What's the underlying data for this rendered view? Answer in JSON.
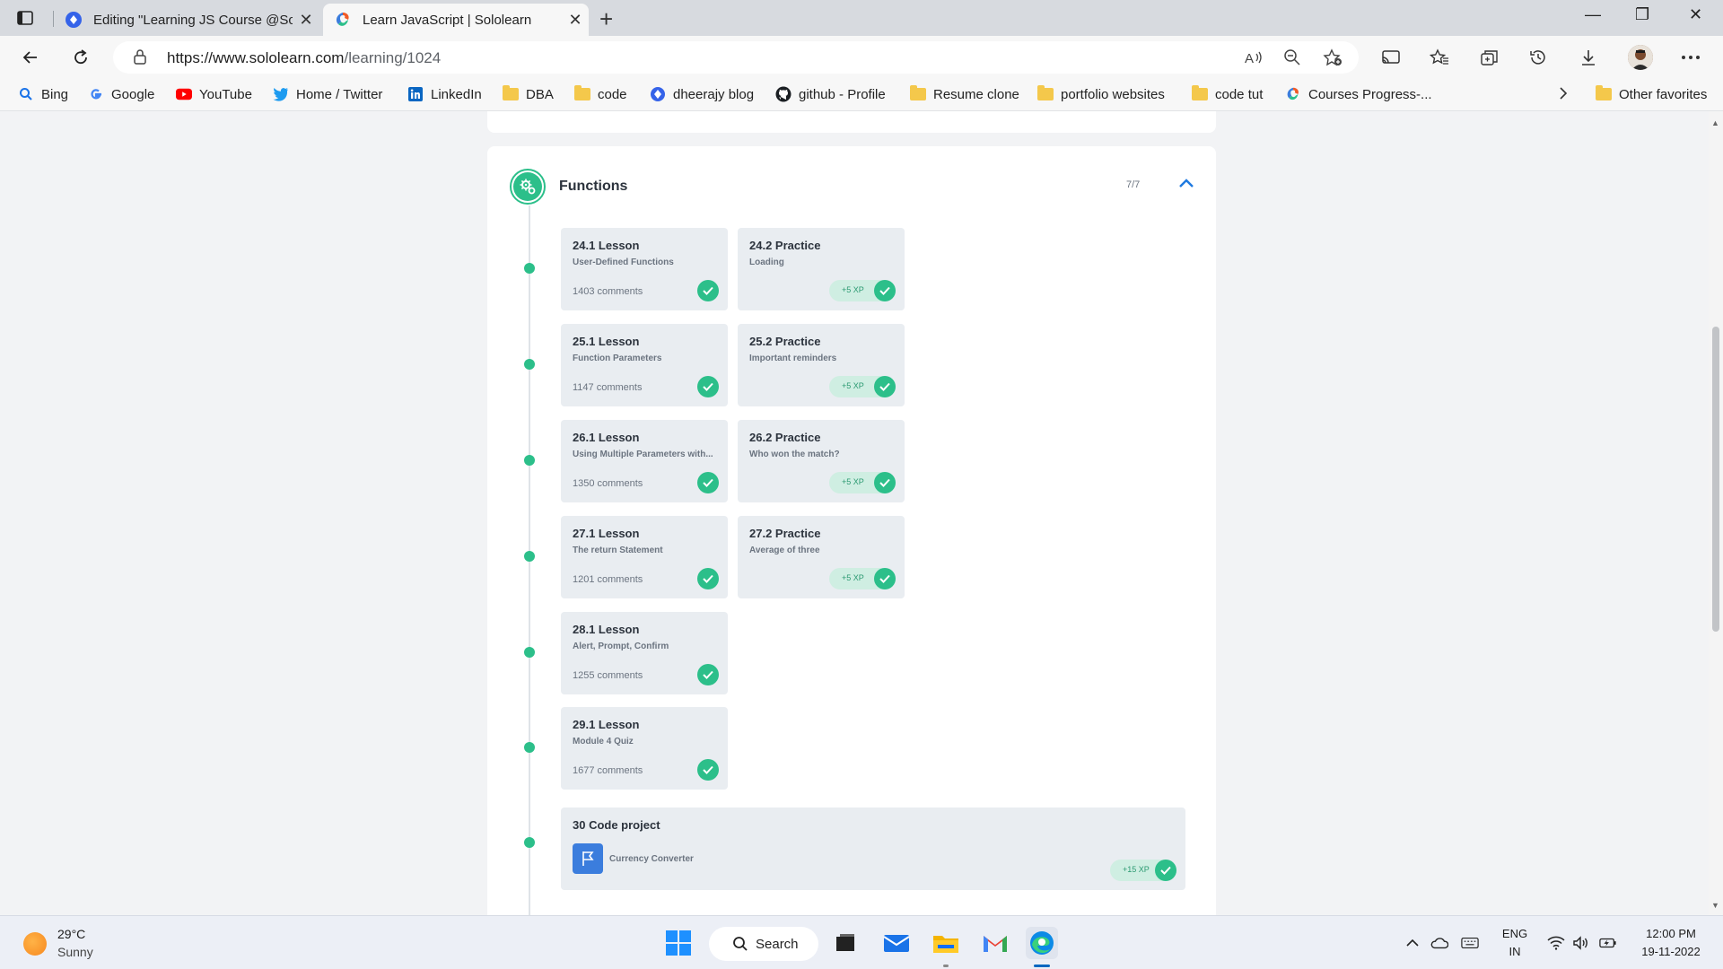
{
  "browser": {
    "tabs": [
      {
        "title": "Editing \"Learning JS Course @Sc",
        "close": "✕"
      },
      {
        "title": "Learn JavaScript | Sololearn",
        "close": "✕"
      }
    ],
    "new_tab": "+",
    "window_controls": {
      "minimize": "—",
      "restore": "❐",
      "close": "✕"
    },
    "url_host": "https://www.sololearn.com",
    "url_path": "/learning/1024",
    "favorites": [
      {
        "label": "Bing",
        "icon": "bing-search-icon"
      },
      {
        "label": "Google",
        "icon": "google-icon"
      },
      {
        "label": "YouTube",
        "icon": "youtube-icon"
      },
      {
        "label": "Home / Twitter",
        "icon": "twitter-icon"
      },
      {
        "label": "LinkedIn",
        "icon": "linkedin-icon"
      },
      {
        "label": "DBA",
        "icon": "folder-icon"
      },
      {
        "label": "code",
        "icon": "folder-icon"
      },
      {
        "label": "dheerajy blog",
        "icon": "blog-icon"
      },
      {
        "label": "github - Profile",
        "icon": "github-icon"
      },
      {
        "label": "Resume clone",
        "icon": "folder-icon"
      },
      {
        "label": "portfolio websites",
        "icon": "folder-icon"
      },
      {
        "label": "code tut",
        "icon": "folder-icon"
      },
      {
        "label": "Courses Progress-...",
        "icon": "sololearn-icon"
      }
    ],
    "other_favorites": "Other favorites"
  },
  "module": {
    "title": "Functions",
    "progress": "7/7",
    "rows": [
      {
        "lesson": {
          "title": "24.1 Lesson",
          "subtitle": "User-Defined Functions",
          "comments": "1403 comments"
        },
        "practice": {
          "title": "24.2 Practice",
          "subtitle": "Loading",
          "xp": "+5 XP"
        }
      },
      {
        "lesson": {
          "title": "25.1 Lesson",
          "subtitle": "Function Parameters",
          "comments": "1147 comments"
        },
        "practice": {
          "title": "25.2 Practice",
          "subtitle": "Important reminders",
          "xp": "+5 XP"
        }
      },
      {
        "lesson": {
          "title": "26.1 Lesson",
          "subtitle": "Using Multiple Parameters with...",
          "comments": "1350 comments"
        },
        "practice": {
          "title": "26.2 Practice",
          "subtitle": "Who won the match?",
          "xp": "+5 XP"
        }
      },
      {
        "lesson": {
          "title": "27.1 Lesson",
          "subtitle": "The return Statement",
          "comments": "1201 comments"
        },
        "practice": {
          "title": "27.2 Practice",
          "subtitle": "Average of three",
          "xp": "+5 XP"
        }
      },
      {
        "lesson": {
          "title": "28.1 Lesson",
          "subtitle": "Alert, Prompt, Confirm",
          "comments": "1255 comments"
        }
      },
      {
        "lesson": {
          "title": "29.1 Lesson",
          "subtitle": "Module 4 Quiz",
          "comments": "1677 comments"
        }
      }
    ],
    "project": {
      "title": "30 Code project",
      "name": "Currency Converter",
      "xp": "+15 XP"
    }
  },
  "taskbar": {
    "weather_temp": "29°C",
    "weather_condition": "Sunny",
    "search_label": "Search",
    "language": "ENG",
    "region": "IN",
    "time": "12:00 PM",
    "date": "19-11-2022"
  },
  "colors": {
    "accent_green": "#2cbf8a",
    "tile_bg": "#e9edf1",
    "xp_pill": "#cfeee2",
    "edge_blue": "#0067c0"
  }
}
